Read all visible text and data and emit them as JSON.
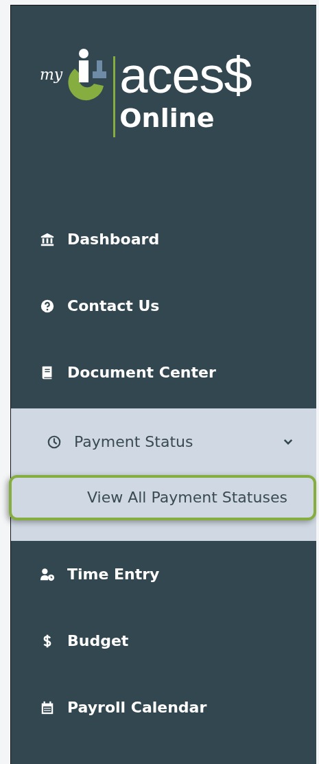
{
  "logo": {
    "prefix": "my",
    "title": "aces$",
    "subtitle": "Online"
  },
  "menu": [
    {
      "label": "Dashboard",
      "expanded": false
    },
    {
      "label": "Contact Us",
      "expanded": false
    },
    {
      "label": "Document Center",
      "expanded": false
    },
    {
      "label": "Payment Status",
      "expanded": true,
      "children": [
        {
          "label": "View All Payment Statuses",
          "selected": true
        }
      ]
    },
    {
      "label": "Time Entry",
      "expanded": false
    },
    {
      "label": "Budget",
      "expanded": false
    },
    {
      "label": "Payroll Calendar",
      "expanded": false
    }
  ]
}
